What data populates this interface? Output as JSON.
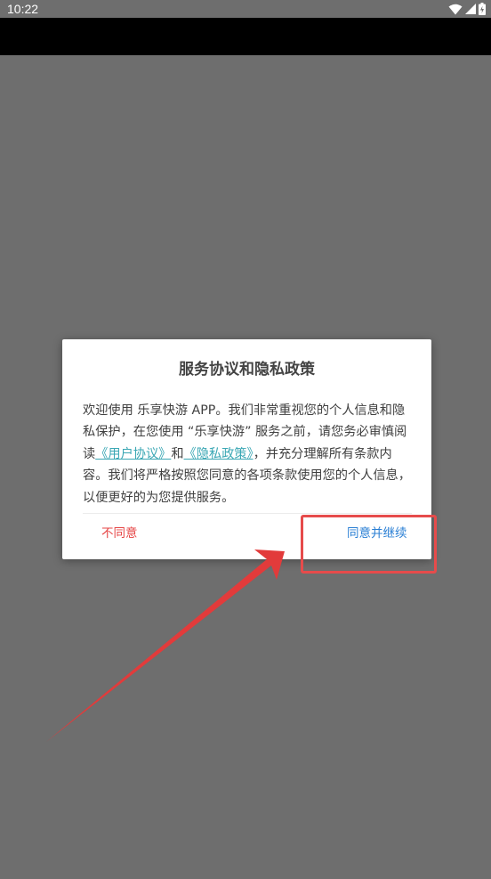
{
  "status_bar": {
    "time": "10:22",
    "icons": [
      "wifi-icon",
      "cell-signal-icon",
      "battery-icon"
    ]
  },
  "dialog": {
    "title": "服务协议和隐私政策",
    "body": {
      "part1": "欢迎使用 乐享快游 APP。我们非常重视您的个人信息和隐私保护，在您使用 “乐享快游” 服务之前，请您务必审慎阅读",
      "link_user_agreement": "《用户协议》",
      "and": "和",
      "link_privacy_policy": "《隐私政策》",
      "part2": "，并充分理解所有条款内容。我们将严格按照您同意的各项条款使用您的个人信息，以便更好的为您提供服务。"
    },
    "disagree_label": "不同意",
    "agree_label": "同意并继续"
  },
  "colors": {
    "overlay_background": "#6e6e6e",
    "link": "#3aa7b4",
    "disagree": "#e64545",
    "agree": "#2a7fd4",
    "annotation": "#e64b4b"
  }
}
